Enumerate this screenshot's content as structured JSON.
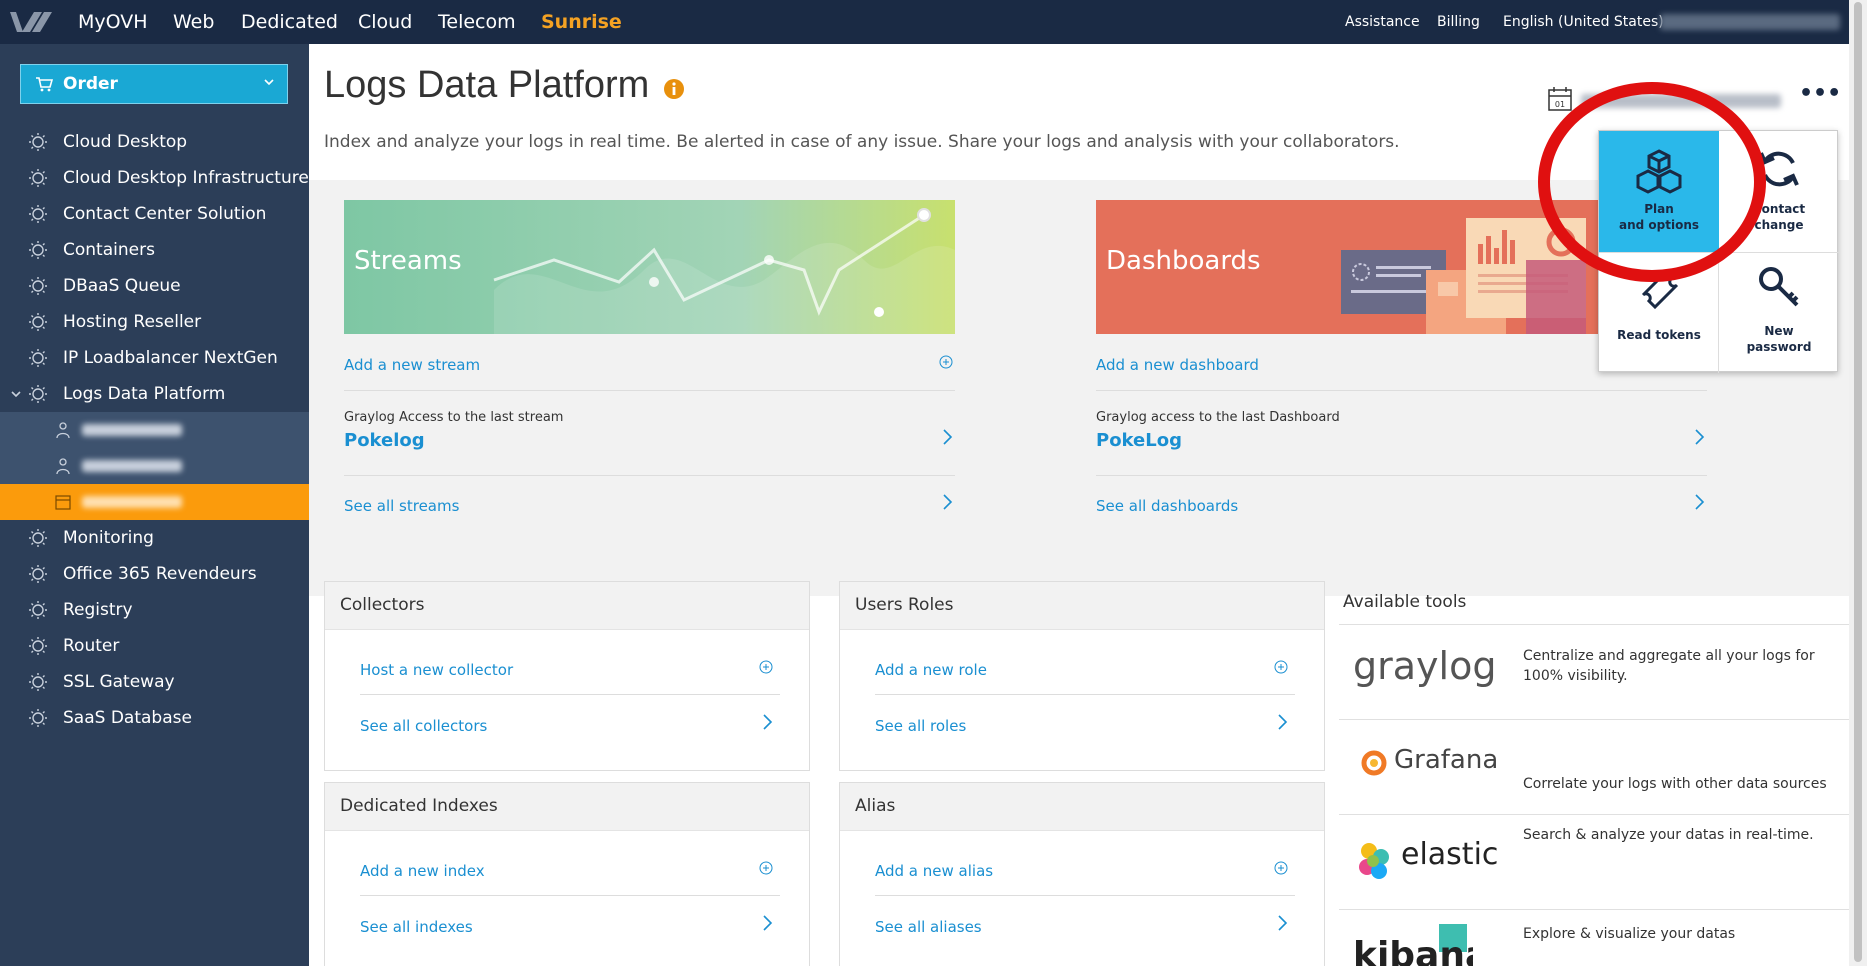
{
  "topnav": {
    "items": [
      "MyOVH",
      "Web",
      "Dedicated",
      "Cloud",
      "Telecom",
      "Sunrise"
    ],
    "right": [
      "Assistance",
      "Billing",
      "English (United States)"
    ]
  },
  "sidebar": {
    "order_label": "Order",
    "items": [
      "Cloud Desktop",
      "Cloud Desktop Infrastructure",
      "Contact Center Solution",
      "Containers",
      "DBaaS Queue",
      "Hosting Reseller",
      "IP Loadbalancer NextGen",
      "Logs Data Platform",
      "Monitoring",
      "Office 365 Revendeurs",
      "Registry",
      "Router",
      "SSL Gateway",
      "SaaS Database"
    ]
  },
  "main": {
    "title": "Logs Data Platform",
    "subtitle": "Index and analyze your logs in real time. Be alerted in case of any issue. Share your logs and analysis with your collaborators.",
    "streams": {
      "banner": "Streams",
      "add": "Add a new stream",
      "access_label": "Graylog Access to the last stream",
      "last": "Pokelog",
      "see_all": "See all streams"
    },
    "dashboards": {
      "banner": "Dashboards",
      "add": "Add a new dashboard",
      "access_label": "Graylog access to the last Dashboard",
      "last": "PokeLog",
      "see_all": "See all dashboards"
    },
    "collectors": {
      "title": "Collectors",
      "add": "Host a new collector",
      "see_all": "See all collectors"
    },
    "roles": {
      "title": "Users Roles",
      "add": "Add a new role",
      "see_all": "See all roles"
    },
    "indexes": {
      "title": "Dedicated Indexes",
      "add": "Add a new index",
      "see_all": "See all indexes"
    },
    "alias": {
      "title": "Alias",
      "add": "Add a new alias",
      "see_all": "See all aliases"
    },
    "tools": {
      "title": "Available tools",
      "items": [
        {
          "name": "graylog",
          "desc": "Centralize and aggregate all your logs for 100% visibility."
        },
        {
          "name": "Grafana",
          "desc": "Correlate your logs with other data sources"
        },
        {
          "name": "elastic",
          "desc": "Search & analyze your datas in real-time."
        },
        {
          "name": "kibana",
          "desc": "Explore & visualize your datas"
        }
      ]
    }
  },
  "popup": {
    "plan": [
      "Plan",
      "and options"
    ],
    "contact": [
      "Contact",
      "change"
    ],
    "tokens": "Read tokens",
    "password": [
      "New",
      "password"
    ]
  },
  "colors": {
    "topnav": "#1a2a44",
    "sidebar": "#2c3e58",
    "accent": "#1aa8d4",
    "active": "#fb9b0c",
    "link": "#1a8fd1",
    "highlight_circle": "#e01010"
  }
}
